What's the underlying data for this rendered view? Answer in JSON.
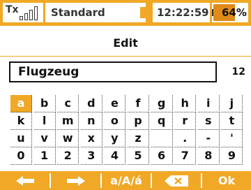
{
  "status_bar": {
    "tx_label": "Tx",
    "signal_bars": 4,
    "model_name": "Standard",
    "time": "12:22:59",
    "battery_percent": "64%",
    "battery_level": 0.64
  },
  "title": "Edit",
  "text_field": {
    "value": "Flugzeug",
    "char_count": "12"
  },
  "keyboard": {
    "rows": [
      [
        "a",
        "b",
        "c",
        "d",
        "e",
        "f",
        "g",
        "h",
        "i",
        "j"
      ],
      [
        "k",
        "l",
        "m",
        "n",
        "o",
        "p",
        "q",
        "r",
        "s",
        "t"
      ],
      [
        "u",
        "v",
        "w",
        "x",
        "y",
        "z",
        " ",
        ".",
        "-",
        "'"
      ],
      [
        "0",
        "1",
        "2",
        "3",
        "4",
        "5",
        "6",
        "7",
        "8",
        "9"
      ]
    ],
    "selected": "a"
  },
  "buttons": {
    "left_icon": "arrow-left-icon",
    "right_icon": "arrow-right-icon",
    "case_label": "a/A/á",
    "backspace_icon": "backspace-icon",
    "ok_label": "Ok"
  },
  "colors": {
    "accent": "#f0a826",
    "text": "#111111"
  }
}
